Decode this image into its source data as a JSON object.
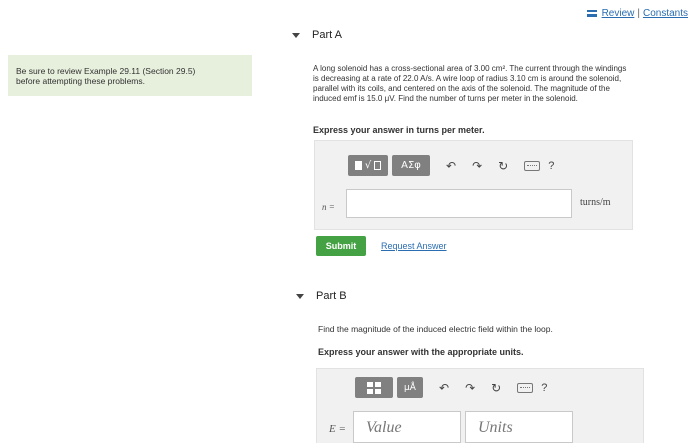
{
  "header": {
    "review_label": "Review",
    "separator": "|",
    "constants_label": "Constants"
  },
  "side_note": {
    "line1": "Be sure to review Example 29.11 (Section 29.5)",
    "line2": "before attempting these problems."
  },
  "partA": {
    "title": "Part A",
    "problem_lines": [
      "A long solenoid has a cross-sectional area of 3.00 cm². The current through the windings",
      "is decreasing at a rate of 22.0 A/s. A wire loop of radius 3.10 cm is around the solenoid,",
      "parallel with its coils, and centered on the axis of the solenoid. The magnitude of the",
      "induced emf is 15.0 μV. Find the number of turns per meter in the solenoid."
    ],
    "instruction": "Express your answer in turns per meter.",
    "toolbar": {
      "greek_label": "ΑΣφ",
      "help_label": "?"
    },
    "variable_label": "n =",
    "input_value": "",
    "unit_label": "turns/m",
    "submit_label": "Submit",
    "request_answer_label": "Request Answer"
  },
  "partB": {
    "title": "Part B",
    "problem": "Find the magnitude of the induced electric field within the loop.",
    "instruction": "Express your answer with the appropriate units.",
    "toolbar": {
      "units_label": "μÅ",
      "help_label": "?"
    },
    "variable_label": "E =",
    "value_placeholder": "Value",
    "units_placeholder": "Units"
  },
  "icons": [
    "bars-icon",
    "chevron-down-icon",
    "undo-icon",
    "redo-icon",
    "reset-icon",
    "keyboard-icon",
    "help-icon",
    "template-icon",
    "grid-template-icon"
  ],
  "colors": {
    "link": "#2a6db0",
    "side_note_bg": "#e7efdd",
    "submit_bg": "#44a244",
    "toolbar_btn": "#808080",
    "answer_box_bg": "#f1f1f1"
  }
}
